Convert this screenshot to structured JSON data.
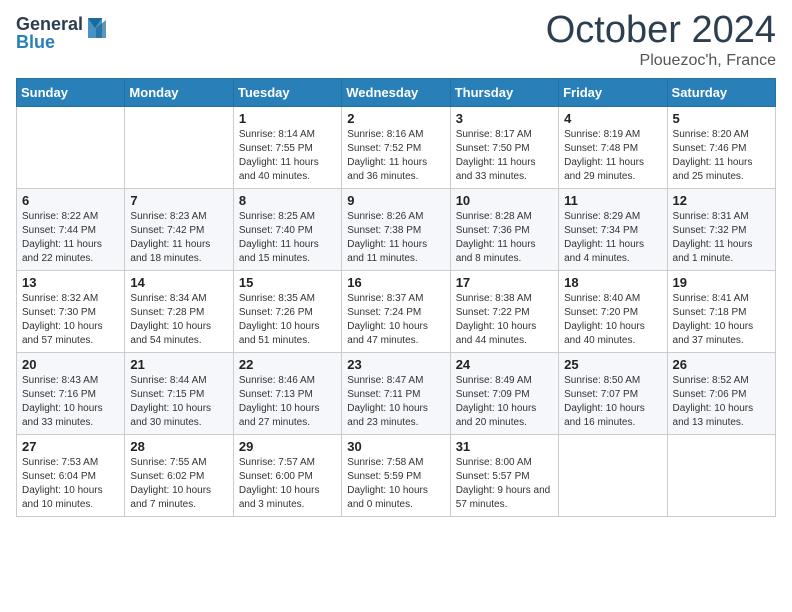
{
  "header": {
    "logo_general": "General",
    "logo_blue": "Blue",
    "month_title": "October 2024",
    "location": "Plouezoc'h, France"
  },
  "weekdays": [
    "Sunday",
    "Monday",
    "Tuesday",
    "Wednesday",
    "Thursday",
    "Friday",
    "Saturday"
  ],
  "weeks": [
    [
      {
        "day": "",
        "sunrise": "",
        "sunset": "",
        "daylight": ""
      },
      {
        "day": "",
        "sunrise": "",
        "sunset": "",
        "daylight": ""
      },
      {
        "day": "1",
        "sunrise": "Sunrise: 8:14 AM",
        "sunset": "Sunset: 7:55 PM",
        "daylight": "Daylight: 11 hours and 40 minutes."
      },
      {
        "day": "2",
        "sunrise": "Sunrise: 8:16 AM",
        "sunset": "Sunset: 7:52 PM",
        "daylight": "Daylight: 11 hours and 36 minutes."
      },
      {
        "day": "3",
        "sunrise": "Sunrise: 8:17 AM",
        "sunset": "Sunset: 7:50 PM",
        "daylight": "Daylight: 11 hours and 33 minutes."
      },
      {
        "day": "4",
        "sunrise": "Sunrise: 8:19 AM",
        "sunset": "Sunset: 7:48 PM",
        "daylight": "Daylight: 11 hours and 29 minutes."
      },
      {
        "day": "5",
        "sunrise": "Sunrise: 8:20 AM",
        "sunset": "Sunset: 7:46 PM",
        "daylight": "Daylight: 11 hours and 25 minutes."
      }
    ],
    [
      {
        "day": "6",
        "sunrise": "Sunrise: 8:22 AM",
        "sunset": "Sunset: 7:44 PM",
        "daylight": "Daylight: 11 hours and 22 minutes."
      },
      {
        "day": "7",
        "sunrise": "Sunrise: 8:23 AM",
        "sunset": "Sunset: 7:42 PM",
        "daylight": "Daylight: 11 hours and 18 minutes."
      },
      {
        "day": "8",
        "sunrise": "Sunrise: 8:25 AM",
        "sunset": "Sunset: 7:40 PM",
        "daylight": "Daylight: 11 hours and 15 minutes."
      },
      {
        "day": "9",
        "sunrise": "Sunrise: 8:26 AM",
        "sunset": "Sunset: 7:38 PM",
        "daylight": "Daylight: 11 hours and 11 minutes."
      },
      {
        "day": "10",
        "sunrise": "Sunrise: 8:28 AM",
        "sunset": "Sunset: 7:36 PM",
        "daylight": "Daylight: 11 hours and 8 minutes."
      },
      {
        "day": "11",
        "sunrise": "Sunrise: 8:29 AM",
        "sunset": "Sunset: 7:34 PM",
        "daylight": "Daylight: 11 hours and 4 minutes."
      },
      {
        "day": "12",
        "sunrise": "Sunrise: 8:31 AM",
        "sunset": "Sunset: 7:32 PM",
        "daylight": "Daylight: 11 hours and 1 minute."
      }
    ],
    [
      {
        "day": "13",
        "sunrise": "Sunrise: 8:32 AM",
        "sunset": "Sunset: 7:30 PM",
        "daylight": "Daylight: 10 hours and 57 minutes."
      },
      {
        "day": "14",
        "sunrise": "Sunrise: 8:34 AM",
        "sunset": "Sunset: 7:28 PM",
        "daylight": "Daylight: 10 hours and 54 minutes."
      },
      {
        "day": "15",
        "sunrise": "Sunrise: 8:35 AM",
        "sunset": "Sunset: 7:26 PM",
        "daylight": "Daylight: 10 hours and 51 minutes."
      },
      {
        "day": "16",
        "sunrise": "Sunrise: 8:37 AM",
        "sunset": "Sunset: 7:24 PM",
        "daylight": "Daylight: 10 hours and 47 minutes."
      },
      {
        "day": "17",
        "sunrise": "Sunrise: 8:38 AM",
        "sunset": "Sunset: 7:22 PM",
        "daylight": "Daylight: 10 hours and 44 minutes."
      },
      {
        "day": "18",
        "sunrise": "Sunrise: 8:40 AM",
        "sunset": "Sunset: 7:20 PM",
        "daylight": "Daylight: 10 hours and 40 minutes."
      },
      {
        "day": "19",
        "sunrise": "Sunrise: 8:41 AM",
        "sunset": "Sunset: 7:18 PM",
        "daylight": "Daylight: 10 hours and 37 minutes."
      }
    ],
    [
      {
        "day": "20",
        "sunrise": "Sunrise: 8:43 AM",
        "sunset": "Sunset: 7:16 PM",
        "daylight": "Daylight: 10 hours and 33 minutes."
      },
      {
        "day": "21",
        "sunrise": "Sunrise: 8:44 AM",
        "sunset": "Sunset: 7:15 PM",
        "daylight": "Daylight: 10 hours and 30 minutes."
      },
      {
        "day": "22",
        "sunrise": "Sunrise: 8:46 AM",
        "sunset": "Sunset: 7:13 PM",
        "daylight": "Daylight: 10 hours and 27 minutes."
      },
      {
        "day": "23",
        "sunrise": "Sunrise: 8:47 AM",
        "sunset": "Sunset: 7:11 PM",
        "daylight": "Daylight: 10 hours and 23 minutes."
      },
      {
        "day": "24",
        "sunrise": "Sunrise: 8:49 AM",
        "sunset": "Sunset: 7:09 PM",
        "daylight": "Daylight: 10 hours and 20 minutes."
      },
      {
        "day": "25",
        "sunrise": "Sunrise: 8:50 AM",
        "sunset": "Sunset: 7:07 PM",
        "daylight": "Daylight: 10 hours and 16 minutes."
      },
      {
        "day": "26",
        "sunrise": "Sunrise: 8:52 AM",
        "sunset": "Sunset: 7:06 PM",
        "daylight": "Daylight: 10 hours and 13 minutes."
      }
    ],
    [
      {
        "day": "27",
        "sunrise": "Sunrise: 7:53 AM",
        "sunset": "Sunset: 6:04 PM",
        "daylight": "Daylight: 10 hours and 10 minutes."
      },
      {
        "day": "28",
        "sunrise": "Sunrise: 7:55 AM",
        "sunset": "Sunset: 6:02 PM",
        "daylight": "Daylight: 10 hours and 7 minutes."
      },
      {
        "day": "29",
        "sunrise": "Sunrise: 7:57 AM",
        "sunset": "Sunset: 6:00 PM",
        "daylight": "Daylight: 10 hours and 3 minutes."
      },
      {
        "day": "30",
        "sunrise": "Sunrise: 7:58 AM",
        "sunset": "Sunset: 5:59 PM",
        "daylight": "Daylight: 10 hours and 0 minutes."
      },
      {
        "day": "31",
        "sunrise": "Sunrise: 8:00 AM",
        "sunset": "Sunset: 5:57 PM",
        "daylight": "Daylight: 9 hours and 57 minutes."
      },
      {
        "day": "",
        "sunrise": "",
        "sunset": "",
        "daylight": ""
      },
      {
        "day": "",
        "sunrise": "",
        "sunset": "",
        "daylight": ""
      }
    ]
  ]
}
